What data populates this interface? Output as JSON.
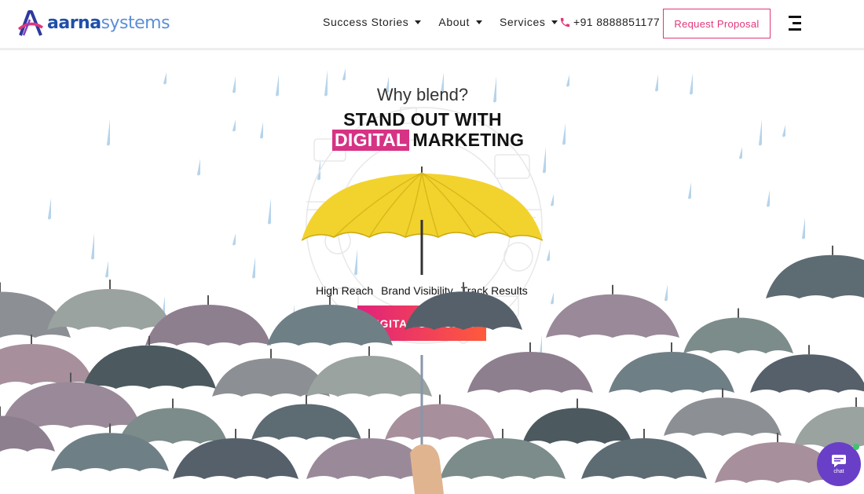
{
  "brand": {
    "name_part1": "aarna",
    "name_part2": "systems"
  },
  "nav": {
    "items": [
      {
        "label": "Success Stories",
        "icon": "chevron-down-icon"
      },
      {
        "label": "About",
        "icon": "chevron-down-icon"
      },
      {
        "label": "Services",
        "icon": "chevron-down-icon"
      }
    ],
    "phone": "+91 8888851177",
    "proposal_label": "Request Proposal"
  },
  "hero": {
    "question": "Why blend?",
    "headline_line1": "STAND OUT WITH",
    "headline_highlight": "DIGITAL",
    "headline_rest": "MARKETING",
    "features": [
      "High Reach",
      "Brand Visibility",
      "Track Results"
    ],
    "cta_label": "DIGITAL SUCCESS"
  },
  "chat": {
    "label": "chat"
  },
  "colors": {
    "accent": "#e2367a",
    "highlight": "#d63384",
    "cta_start": "#e0227c",
    "cta_end": "#ff5a3c",
    "umbrella": "#f2d32e",
    "rain": "#a9cde8",
    "chat": "#6a3fc7"
  }
}
